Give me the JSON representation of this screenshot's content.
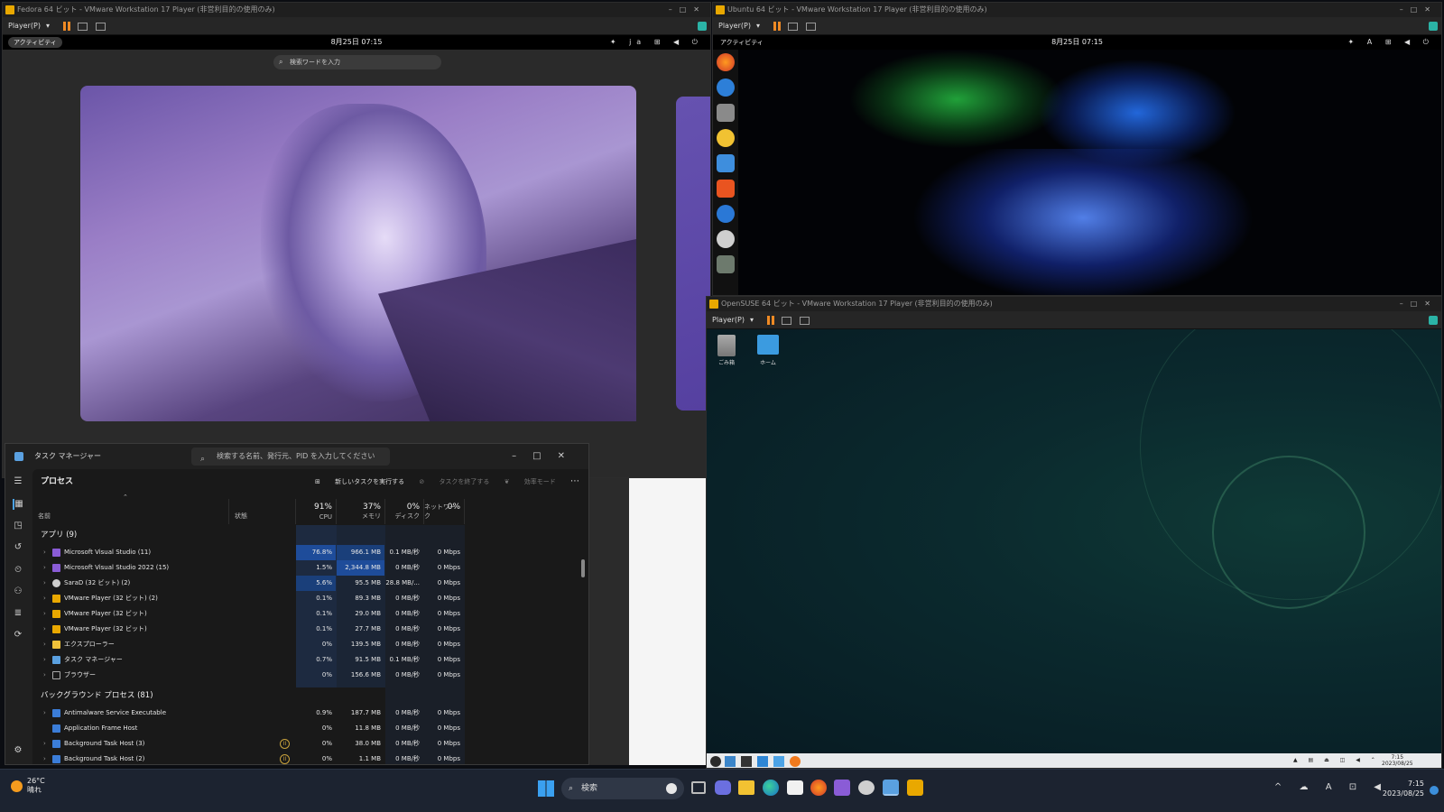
{
  "fedora": {
    "title": "Fedora 64 ビット - VMware Workstation 17 Player (非営利目的の使用のみ)",
    "player_menu": "Player(P)",
    "activities": "アクティビティ",
    "clock": "8月25日 07:15",
    "lang": "ja",
    "search_placeholder": "検索ワードを入力"
  },
  "ubuntu": {
    "title": "Ubuntu 64 ビット - VMware Workstation 17 Player (非営利目的の使用のみ)",
    "player_menu": "Player(P)",
    "activities": "アクティビティ",
    "clock": "8月25日 07:15",
    "lang": "A",
    "dock_icons": [
      "firefox-icon",
      "thunderbird-icon",
      "files-icon",
      "rhythmbox-icon",
      "writer-icon",
      "app-center-icon",
      "help-icon",
      "disc-icon",
      "trash-icon"
    ]
  },
  "opensuse": {
    "title": "OpenSUSE 64 ビット - VMware Workstation 17 Player (非営利目的の使用のみ)",
    "player_menu": "Player(P)",
    "desktop_icons": [
      {
        "name": "trash",
        "label": "ごみ箱"
      },
      {
        "name": "home",
        "label": "ホーム"
      }
    ],
    "clock_time": "7:15",
    "clock_date": "2023/08/25"
  },
  "taskmgr": {
    "title": "タスク マネージャー",
    "search_placeholder": "検索する名前、発行元、PID を入力してください",
    "section": "プロセス",
    "actions": {
      "new_task": "新しいタスクを実行する",
      "end_task": "タスクを終了する",
      "efficiency": "効率モード"
    },
    "columns": {
      "name": "名前",
      "status": "状態",
      "cpu_pct": "91%",
      "cpu": "CPU",
      "mem_pct": "37%",
      "mem": "メモリ",
      "disk_pct": "0%",
      "disk": "ディスク",
      "net_pct": "0%",
      "net": "ネットワーク"
    },
    "group_apps": "アプリ (9)",
    "group_bg": "バックグラウンド プロセス (81)",
    "apps": [
      {
        "name": "Microsoft Visual Studio (11)",
        "cpu": "76.8%",
        "mem": "966.1 MB",
        "disk": "0.1 MB/秒",
        "net": "0 Mbps"
      },
      {
        "name": "Microsoft Visual Studio 2022 (15)",
        "cpu": "1.5%",
        "mem": "2,344.8 MB",
        "disk": "0 MB/秒",
        "net": "0 Mbps"
      },
      {
        "name": "SaraD (32 ビット) (2)",
        "cpu": "5.6%",
        "mem": "95.5 MB",
        "disk": "28.8 MB/...",
        "net": "0 Mbps"
      },
      {
        "name": "VMware Player (32 ビット) (2)",
        "cpu": "0.1%",
        "mem": "89.3 MB",
        "disk": "0 MB/秒",
        "net": "0 Mbps"
      },
      {
        "name": "VMware Player (32 ビット)",
        "cpu": "0.1%",
        "mem": "29.0 MB",
        "disk": "0 MB/秒",
        "net": "0 Mbps"
      },
      {
        "name": "VMware Player (32 ビット)",
        "cpu": "0.1%",
        "mem": "27.7 MB",
        "disk": "0 MB/秒",
        "net": "0 Mbps"
      },
      {
        "name": "エクスプローラー",
        "cpu": "0%",
        "mem": "139.5 MB",
        "disk": "0 MB/秒",
        "net": "0 Mbps"
      },
      {
        "name": "タスク マネージャー",
        "cpu": "0.7%",
        "mem": "91.5 MB",
        "disk": "0.1 MB/秒",
        "net": "0 Mbps"
      },
      {
        "name": "ブラウザー",
        "cpu": "0%",
        "mem": "156.6 MB",
        "disk": "0 MB/秒",
        "net": "0 Mbps"
      }
    ],
    "bg": [
      {
        "name": "Antimalware Service Executable",
        "cpu": "0.9%",
        "mem": "187.7 MB",
        "disk": "0 MB/秒",
        "net": "0 Mbps"
      },
      {
        "name": "Application Frame Host",
        "cpu": "0%",
        "mem": "11.8 MB",
        "disk": "0 MB/秒",
        "net": "0 Mbps"
      },
      {
        "name": "Background Task Host (3)",
        "cpu": "0%",
        "mem": "38.0 MB",
        "disk": "0 MB/秒",
        "net": "0 Mbps"
      },
      {
        "name": "Background Task Host (2)",
        "cpu": "0%",
        "mem": "1.1 MB",
        "disk": "0 MB/秒",
        "net": "0 Mbps"
      }
    ]
  },
  "taskbar": {
    "temp": "26°C",
    "weather": "晴れ",
    "search": "検索",
    "time": "7:15",
    "date": "2023/08/25",
    "ime": "A"
  },
  "colors": {
    "cpu_hot": "#1e4c9a",
    "cpu_warm": "#1a3f7a",
    "accent": "#f08a24"
  }
}
